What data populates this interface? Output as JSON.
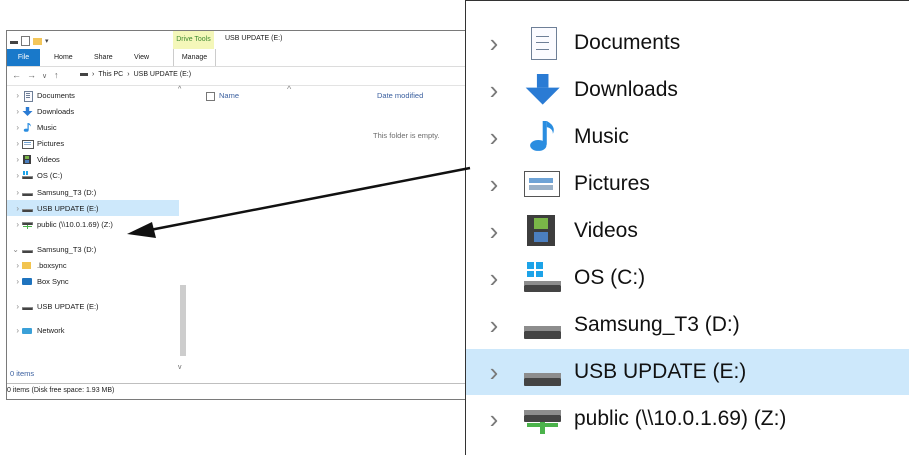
{
  "window": {
    "title": "USB UPDATE (E:)",
    "context_tab": "Drive Tools",
    "ribbon_tabs": [
      "File",
      "Home",
      "Share",
      "View",
      "Manage"
    ],
    "breadcrumb": [
      "This PC",
      "USB UPDATE (E:)"
    ],
    "nav_items": [
      {
        "label": "Documents",
        "icon": "documents-icon",
        "expanded": false
      },
      {
        "label": "Downloads",
        "icon": "downloads-icon",
        "expanded": false
      },
      {
        "label": "Music",
        "icon": "music-icon",
        "expanded": false
      },
      {
        "label": "Pictures",
        "icon": "pictures-icon",
        "expanded": false
      },
      {
        "label": "Videos",
        "icon": "videos-icon",
        "expanded": false
      },
      {
        "label": "OS (C:)",
        "icon": "windows-drive-icon",
        "expanded": false
      },
      {
        "label": "Samsung_T3 (D:)",
        "icon": "drive-icon",
        "expanded": false
      },
      {
        "label": "USB UPDATE (E:)",
        "icon": "drive-icon",
        "expanded": false,
        "selected": true
      },
      {
        "label": "public (\\\\10.0.1.69) (Z:)",
        "icon": "network-drive-icon",
        "expanded": false
      },
      {
        "label": "Samsung_T3 (D:)",
        "icon": "drive-icon",
        "expanded": true
      },
      {
        "label": ".boxsync",
        "icon": "folder-icon",
        "expanded": false
      },
      {
        "label": "Box Sync",
        "icon": "box-sync-icon",
        "expanded": false
      },
      {
        "label": "USB UPDATE (E:)",
        "icon": "drive-icon",
        "expanded": false
      },
      {
        "label": "Network",
        "icon": "network-icon",
        "expanded": false
      }
    ],
    "columns": {
      "name": "Name",
      "date": "Date modified"
    },
    "empty_message": "This folder is empty.",
    "item_count": "0 items",
    "status": "0 items (Disk free space: 1.93 MB)"
  },
  "zoom": {
    "items": [
      {
        "label": "Documents",
        "icon": "documents-icon"
      },
      {
        "label": "Downloads",
        "icon": "downloads-icon"
      },
      {
        "label": "Music",
        "icon": "music-icon"
      },
      {
        "label": "Pictures",
        "icon": "pictures-icon"
      },
      {
        "label": "Videos",
        "icon": "videos-icon"
      },
      {
        "label": "OS (C:)",
        "icon": "windows-drive-icon"
      },
      {
        "label": "Samsung_T3 (D:)",
        "icon": "drive-icon"
      },
      {
        "label": "USB UPDATE (E:)",
        "icon": "drive-icon",
        "selected": true
      },
      {
        "label": "public (\\\\10.0.1.69) (Z:)",
        "icon": "network-drive-icon"
      }
    ]
  },
  "colors": {
    "selection": "#cde8fb",
    "file_tab": "#1979ca",
    "context_tab_bg": "#f4f7b9",
    "context_tab_text": "#3f8a30",
    "download_arrow": "#2a7bd4",
    "music_note": "#2a8de0"
  }
}
